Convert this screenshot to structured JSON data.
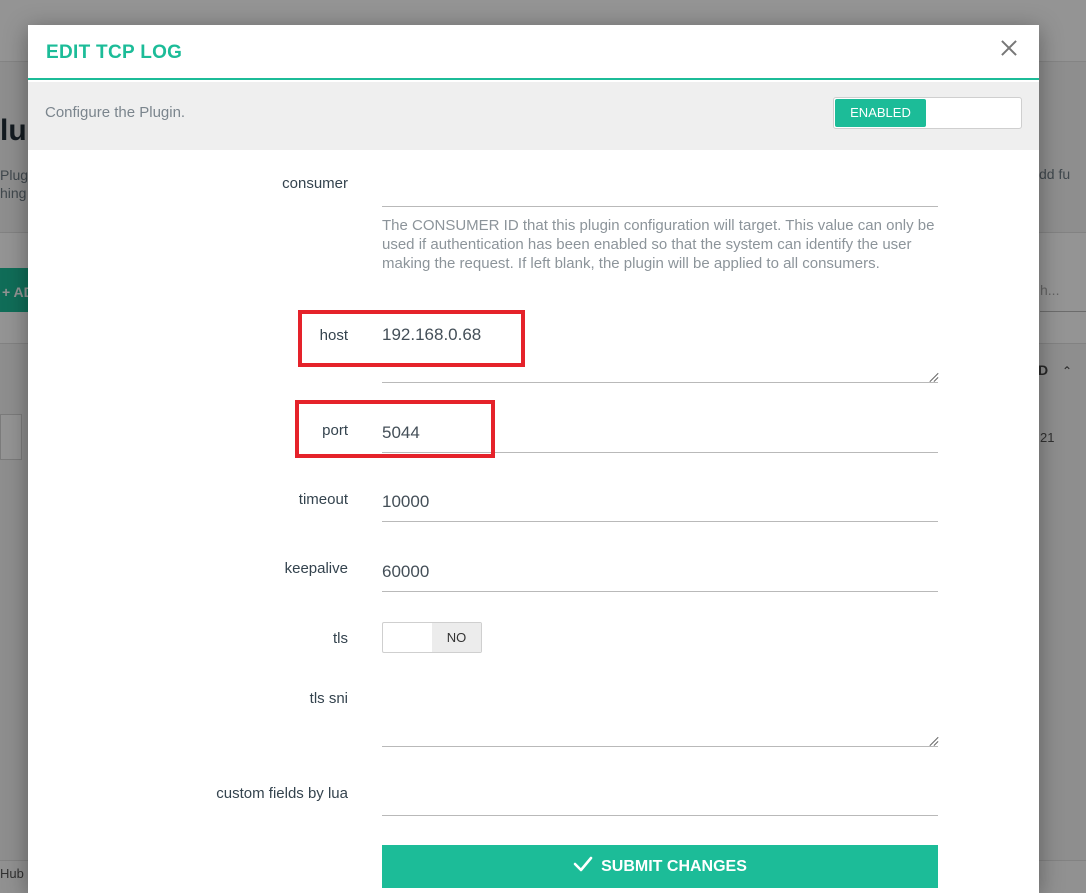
{
  "background": {
    "page_title_fragment": "lu",
    "desc_line1": "Plug",
    "desc_line2": "hing",
    "add_button_fragment": "+ AD",
    "right_text_fragment": "dd fu",
    "search_fragment": "h...",
    "column_fragment": "D",
    "row_value_fragment": "21",
    "footer_fragment": "Hub"
  },
  "modal": {
    "title": "EDIT TCP LOG",
    "subtitle": "Configure the Plugin.",
    "enabled_label": "ENABLED",
    "fields": {
      "consumer": {
        "label": "consumer",
        "value": "",
        "help": "The CONSUMER ID that this plugin configuration will target. This value can only be used if authentication has been enabled so that the system can identify the user making the request. If left blank, the plugin will be applied to all consumers."
      },
      "host": {
        "label": "host",
        "value": "192.168.0.68"
      },
      "port": {
        "label": "port",
        "value": "5044"
      },
      "timeout": {
        "label": "timeout",
        "value": "10000"
      },
      "keepalive": {
        "label": "keepalive",
        "value": "60000"
      },
      "tls": {
        "label": "tls",
        "toggle_label": "NO"
      },
      "tls_sni": {
        "label": "tls sni",
        "value": ""
      },
      "custom_fields_by_lua": {
        "label": "custom fields by lua",
        "value": ""
      }
    },
    "submit_label": "SUBMIT CHANGES"
  },
  "colors": {
    "accent": "#1cbc98",
    "highlight": "#e5222a"
  }
}
